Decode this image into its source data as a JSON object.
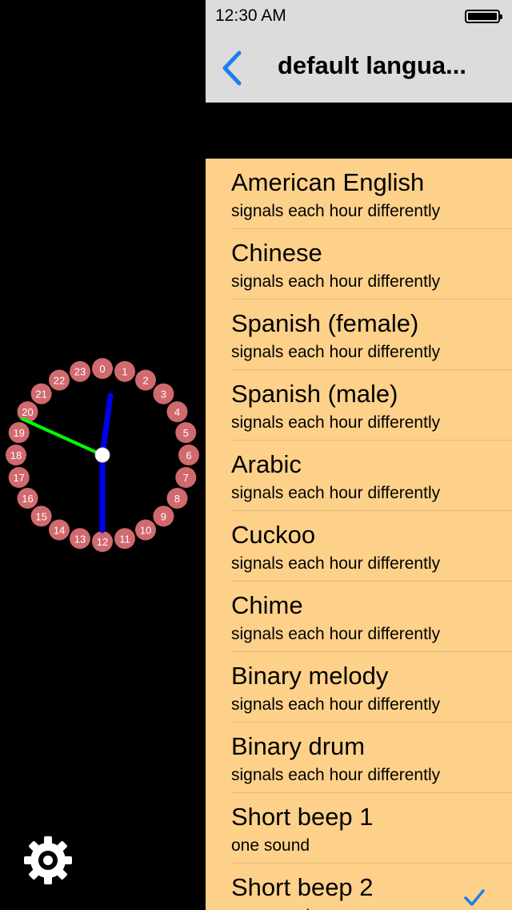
{
  "status_bar": {
    "time": "12:30 AM"
  },
  "navbar": {
    "title": "default langua..."
  },
  "clock": {
    "hour_labels": [
      "0",
      "1",
      "2",
      "3",
      "4",
      "5",
      "6",
      "7",
      "8",
      "9",
      "10",
      "11",
      "12",
      "13",
      "14",
      "15",
      "16",
      "17",
      "18",
      "19",
      "20",
      "21",
      "22",
      "23"
    ],
    "bead_color": "#d06a6e",
    "hand_color_hour": "#0000ee",
    "hand_color_second": "#00ff00"
  },
  "languages": [
    {
      "title": "American English",
      "subtitle": "signals each hour differently"
    },
    {
      "title": "Chinese",
      "subtitle": "signals each hour differently"
    },
    {
      "title": "Spanish (female)",
      "subtitle": "signals each hour differently"
    },
    {
      "title": "Spanish (male)",
      "subtitle": "signals each hour differently"
    },
    {
      "title": "Arabic",
      "subtitle": "signals each hour differently"
    },
    {
      "title": "Cuckoo",
      "subtitle": "signals each hour differently"
    },
    {
      "title": "Chime",
      "subtitle": "signals each hour differently"
    },
    {
      "title": "Binary melody",
      "subtitle": "signals each hour differently"
    },
    {
      "title": "Binary drum",
      "subtitle": "signals each hour differently"
    },
    {
      "title": "Short beep 1",
      "subtitle": "one sound"
    },
    {
      "title": "Short beep 2",
      "subtitle": "one sound",
      "selected": true
    }
  ],
  "colors": {
    "list_bg": "#fed18a",
    "accent": "#1a7ff0",
    "navbar_bg": "#dcdcdc"
  }
}
